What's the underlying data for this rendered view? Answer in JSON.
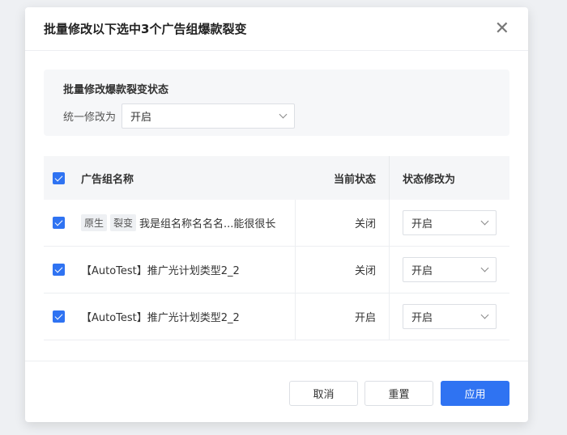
{
  "dialog": {
    "title": "批量修改以下选中3个广告组爆款裂变",
    "close_icon": "close-icon"
  },
  "batch": {
    "title": "批量修改爆款裂变状态",
    "label": "统一修改为",
    "value": "开启"
  },
  "table": {
    "headers": {
      "name": "广告组名称",
      "current": "当前状态",
      "change": "状态修改为"
    },
    "header_checked": true,
    "rows": [
      {
        "checked": true,
        "tags": [
          "原生",
          "裂变"
        ],
        "name": "我是组名称名名名...能很很长",
        "current": "关闭",
        "change": "开启"
      },
      {
        "checked": true,
        "tags": [],
        "name": "【AutoTest】推广光计划类型2_2",
        "current": "关闭",
        "change": "开启"
      },
      {
        "checked": true,
        "tags": [],
        "name": "【AutoTest】推广光计划类型2_2",
        "current": "开启",
        "change": "开启"
      }
    ]
  },
  "footer": {
    "cancel": "取消",
    "reset": "重置",
    "apply": "应用"
  },
  "colors": {
    "primary": "#2f73f2"
  }
}
